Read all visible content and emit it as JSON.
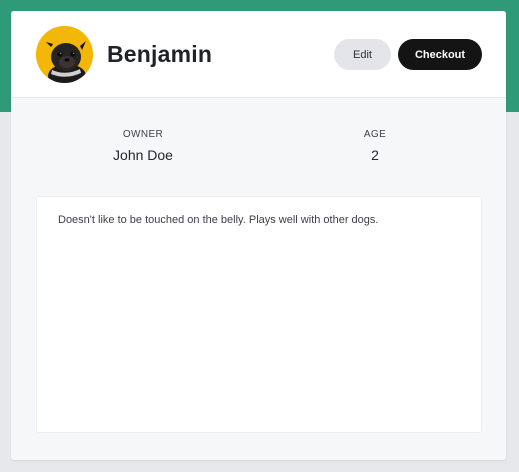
{
  "pet": {
    "name": "Benjamin"
  },
  "actions": {
    "edit_label": "Edit",
    "checkout_label": "Checkout"
  },
  "info": {
    "owner_label": "OWNER",
    "owner_value": "John Doe",
    "age_label": "AGE",
    "age_value": "2"
  },
  "notes": {
    "text": "Doesn't like to be touched on the belly. Plays well with other dogs."
  },
  "colors": {
    "header_band": "#2f9a78",
    "avatar_bg": "#f2b707",
    "checkout_button": "#141414",
    "edit_button": "#e4e5ea"
  }
}
